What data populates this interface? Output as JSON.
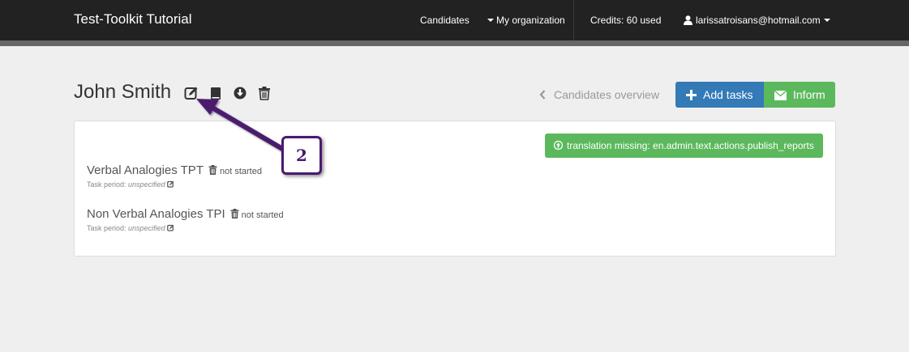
{
  "navbar": {
    "brand": "Test-Toolkit Tutorial",
    "candidates": "Candidates",
    "organization": "My organization",
    "credits": "Credits: 60 used",
    "user_email": "larissatroisans@hotmail.com"
  },
  "header": {
    "title": "John Smith",
    "icons": [
      "edit-icon",
      "book-icon",
      "download-icon",
      "trash-icon"
    ],
    "overview_link": "Candidates overview",
    "add_tasks_label": "Add tasks",
    "inform_label": "Inform"
  },
  "panel": {
    "publish_label": "translation missing: en.admin.text.actions.publish_reports",
    "tasks": [
      {
        "name": "Verbal Analogies TPT",
        "status": "not started",
        "period_label": "Task period:",
        "period_value": "unspecified"
      },
      {
        "name": "Non Verbal Analogies TPI",
        "status": "not started",
        "period_label": "Task period:",
        "period_value": "unspecified"
      }
    ]
  },
  "annotation": {
    "number": "2"
  },
  "colors": {
    "navbar_bg": "#222222",
    "primary": "#337ab7",
    "success": "#5cb85c",
    "annotation": "#4b1a6e"
  }
}
